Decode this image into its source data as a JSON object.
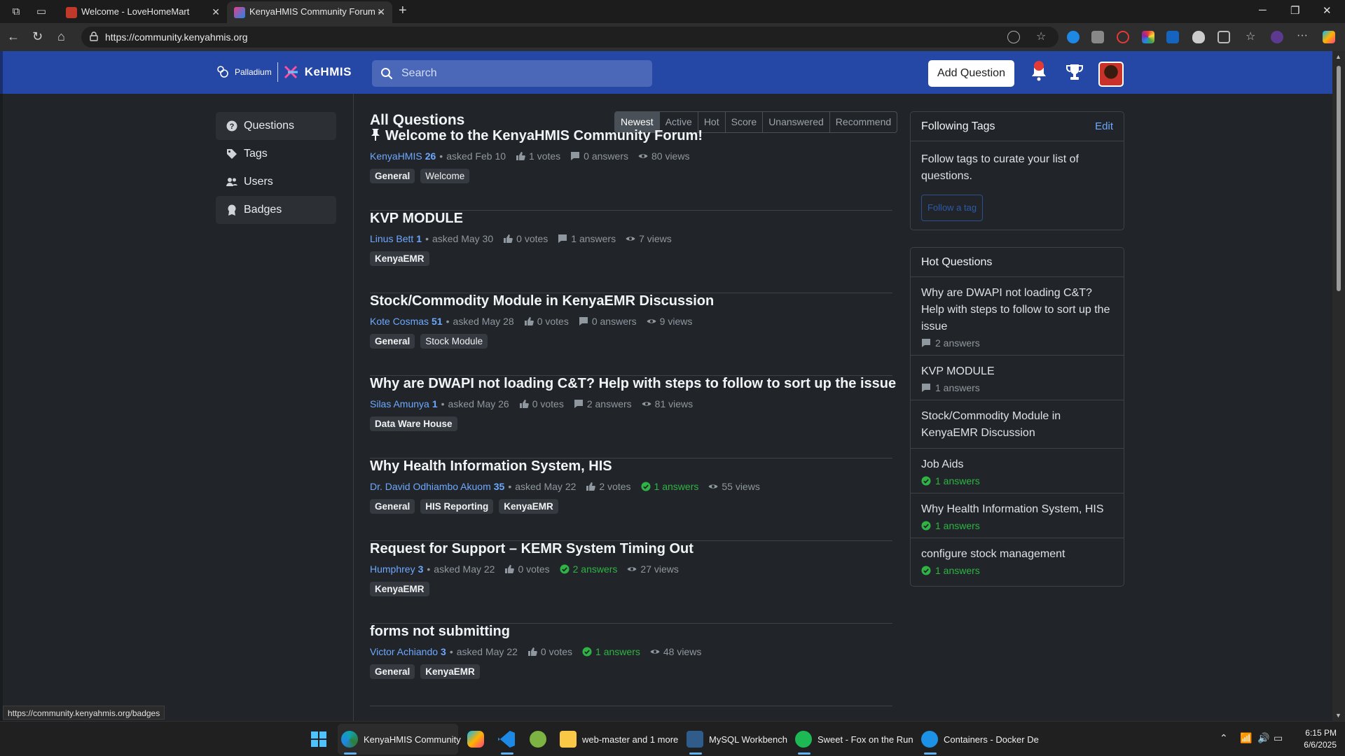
{
  "browser": {
    "tabs": [
      {
        "title": "Welcome - LoveHomeMart"
      },
      {
        "title": "KenyaHMIS Community Forum - "
      }
    ],
    "url": "https://community.kenyahmis.org",
    "status_url": "https://community.kenyahmis.org/badges"
  },
  "header": {
    "logo_left": "Palladium",
    "logo_right": "KeHMIS",
    "search_placeholder": "Search",
    "add_question": "Add Question"
  },
  "sidebar": {
    "items": [
      {
        "label": "Questions",
        "icon": "question-circle-icon",
        "active": true
      },
      {
        "label": "Tags",
        "icon": "tag-icon",
        "active": false
      },
      {
        "label": "Users",
        "icon": "users-icon",
        "active": false
      },
      {
        "label": "Badges",
        "icon": "badge-icon",
        "active": true
      }
    ]
  },
  "main": {
    "title": "All Questions",
    "sort": [
      "Newest",
      "Active",
      "Hot",
      "Score",
      "Unanswered",
      "Recommend"
    ],
    "sort_selected": "Newest",
    "questions": [
      {
        "title": "Welcome to the KenyaHMIS Community Forum!",
        "pinned": true,
        "author": "KenyaHMIS",
        "rep": "26",
        "asked": "asked Feb 10",
        "votes": "1 votes",
        "answers": "0 answers",
        "answered": false,
        "views": "80 views",
        "tags": [
          {
            "name": "General",
            "bold": true
          },
          {
            "name": "Welcome",
            "bold": false
          }
        ]
      },
      {
        "title": "KVP MODULE",
        "pinned": false,
        "author": "Linus Bett",
        "rep": "1",
        "asked": "asked May 30",
        "votes": "0 votes",
        "answers": "1 answers",
        "answered": false,
        "views": "7 views",
        "tags": [
          {
            "name": "KenyaEMR",
            "bold": true
          }
        ]
      },
      {
        "title": "Stock/Commodity Module in KenyaEMR Discussion",
        "pinned": false,
        "author": "Kote Cosmas",
        "rep": "51",
        "asked": "asked May 28",
        "votes": "0 votes",
        "answers": "0 answers",
        "answered": false,
        "views": "9 views",
        "tags": [
          {
            "name": "General",
            "bold": true
          },
          {
            "name": "Stock Module",
            "bold": false
          }
        ]
      },
      {
        "title": "Why are DWAPI not loading C&T? Help with steps to follow to sort up the issue",
        "pinned": false,
        "author": "Silas Amunya",
        "rep": "1",
        "asked": "asked May 26",
        "votes": "0 votes",
        "answers": "2 answers",
        "answered": false,
        "views": "81 views",
        "tags": [
          {
            "name": "Data Ware House",
            "bold": true
          }
        ]
      },
      {
        "title": "Why Health Information System, HIS",
        "pinned": false,
        "author": "Dr. David Odhiambo Akuom",
        "rep": "35",
        "asked": "asked May 22",
        "votes": "2 votes",
        "answers": "1 answers",
        "answered": true,
        "views": "55 views",
        "tags": [
          {
            "name": "General",
            "bold": true
          },
          {
            "name": "HIS Reporting",
            "bold": true
          },
          {
            "name": "KenyaEMR",
            "bold": true
          }
        ]
      },
      {
        "title": "Request for Support – KEMR System Timing Out",
        "pinned": false,
        "author": "Humphrey",
        "rep": "3",
        "asked": "asked May 22",
        "votes": "0 votes",
        "answers": "2 answers",
        "answered": true,
        "views": "27 views",
        "tags": [
          {
            "name": "KenyaEMR",
            "bold": true
          }
        ]
      },
      {
        "title": "forms not submitting",
        "pinned": false,
        "author": "Victor Achiando",
        "rep": "3",
        "asked": "asked May 22",
        "votes": "0 votes",
        "answers": "1 answers",
        "answered": true,
        "views": "48 views",
        "tags": [
          {
            "name": "General",
            "bold": true
          },
          {
            "name": "KenyaEMR",
            "bold": true
          }
        ]
      }
    ]
  },
  "following": {
    "title": "Following Tags",
    "edit": "Edit",
    "text": "Follow tags to curate your list of questions.",
    "button": "Follow a tag"
  },
  "hot": {
    "title": "Hot Questions",
    "items": [
      {
        "title": "Why are DWAPI not loading C&T? Help with steps to follow to sort up the issue",
        "answers": "2 answers",
        "accepted": false
      },
      {
        "title": "KVP MODULE",
        "answers": "1 answers",
        "accepted": false
      },
      {
        "title": "Stock/Commodity Module in KenyaEMR Discussion",
        "answers": "",
        "accepted": false
      },
      {
        "title": "Job Aids",
        "answers": "1 answers",
        "accepted": true
      },
      {
        "title": "Why Health Information System, HIS",
        "answers": "1 answers",
        "accepted": true
      },
      {
        "title": "configure stock management",
        "answers": "1 answers",
        "accepted": true
      }
    ]
  },
  "taskbar": {
    "items": [
      {
        "label": "KenyaHMIS Community",
        "icon": "edge-icon"
      },
      {
        "label": "",
        "icon": "copilot-icon"
      },
      {
        "label": "",
        "icon": "vscode-icon"
      },
      {
        "label": "",
        "icon": "app-icon"
      },
      {
        "label": "web-master and 1 more",
        "icon": "folder-icon"
      },
      {
        "label": "MySQL Workbench",
        "icon": "mysql-icon"
      },
      {
        "label": "Sweet - Fox on the Run",
        "icon": "spotify-icon"
      },
      {
        "label": "Containers - Docker De",
        "icon": "docker-icon"
      }
    ],
    "time": "6:15 PM",
    "date": "6/6/2025"
  }
}
